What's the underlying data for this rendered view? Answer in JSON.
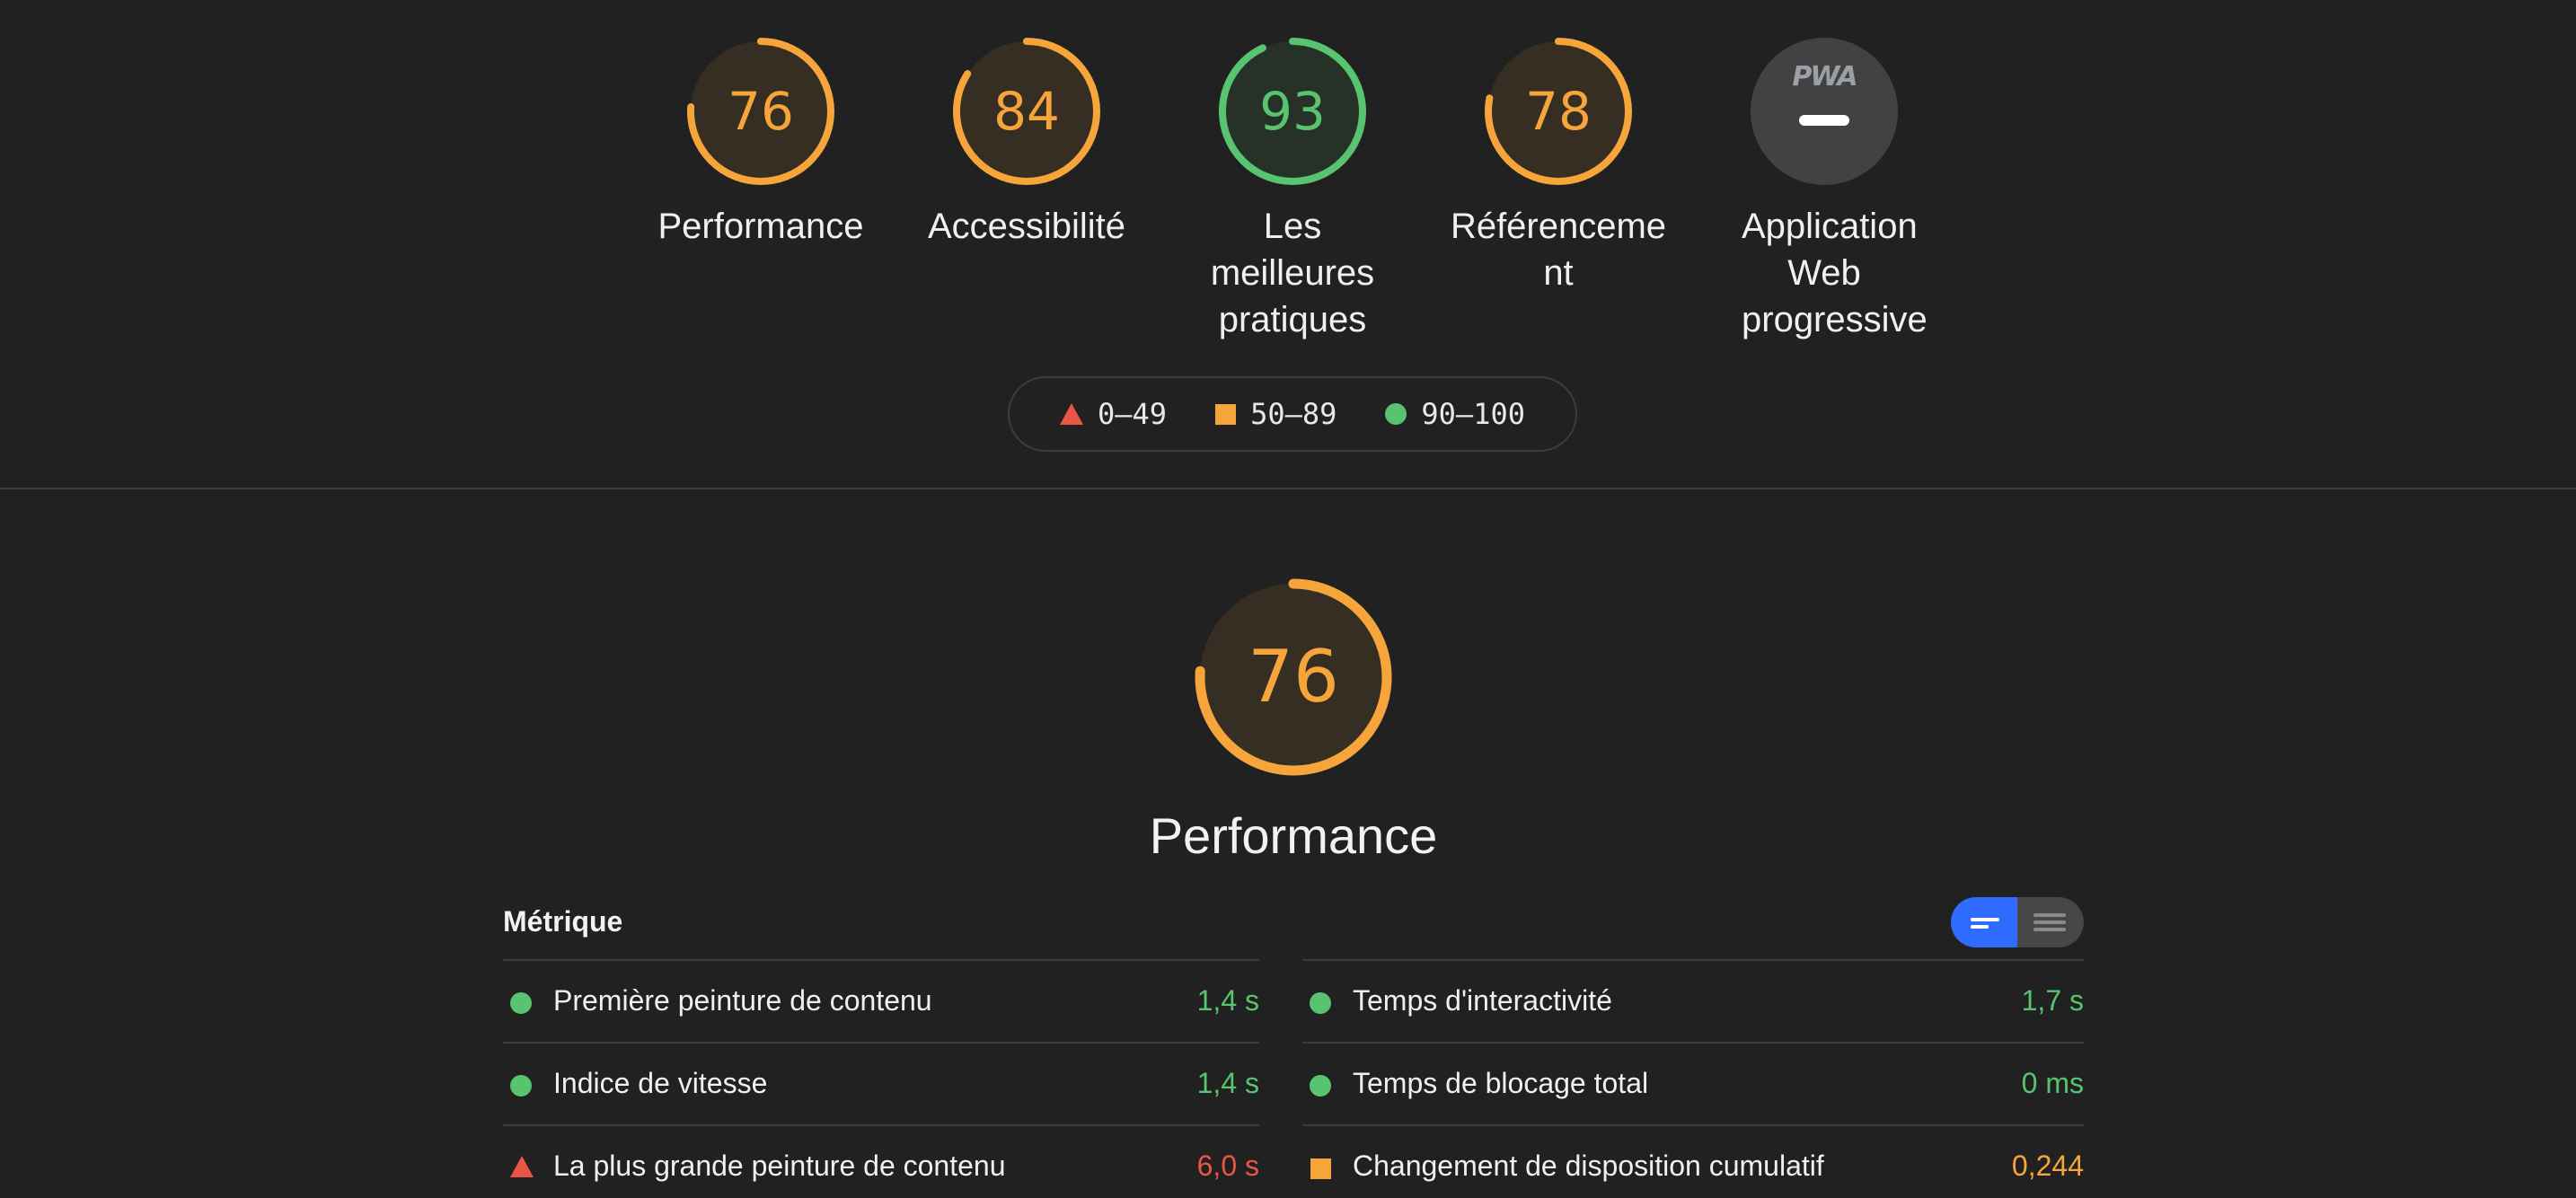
{
  "colors": {
    "background": "#212121",
    "fail": "#eb5545",
    "average": "#f6a53b",
    "pass": "#58c46f",
    "neutral": "#9aa0a6",
    "toggle_active": "#2f6bff"
  },
  "categories": [
    {
      "id": "performance",
      "score": "76",
      "label": "Performance",
      "rating": "average",
      "progress": 0.76
    },
    {
      "id": "accessibility",
      "score": "84",
      "label": "Accessibilité",
      "rating": "average",
      "progress": 0.84
    },
    {
      "id": "best-practices",
      "score": "93",
      "label": "Les meilleures pratiques",
      "rating": "pass",
      "progress": 0.93
    },
    {
      "id": "seo",
      "score": "78",
      "label": "Référencement",
      "rating": "average",
      "progress": 0.78
    },
    {
      "id": "pwa",
      "badge_icon": "pwa-logo-icon",
      "badge_text": "PWA",
      "label": "Application Web progressive",
      "rating": "neutral"
    }
  ],
  "legend": [
    {
      "shape": "triangle",
      "color": "#eb5545",
      "label": "0–49"
    },
    {
      "shape": "square",
      "color": "#f6a53b",
      "label": "50–89"
    },
    {
      "shape": "circle",
      "color": "#58c46f",
      "label": "90–100"
    }
  ],
  "performance": {
    "score": "76",
    "progress": 0.76,
    "title": "Performance",
    "metrics_header": "Métrique",
    "view_toggle": {
      "active": "detailed-view-icon",
      "inactive": "list-view-icon"
    },
    "metrics_left": [
      {
        "icon": "circle",
        "name": "Première peinture de contenu",
        "value": "1,4 s",
        "rating": "pass"
      },
      {
        "icon": "circle",
        "name": "Indice de vitesse",
        "value": "1,4 s",
        "rating": "pass"
      },
      {
        "icon": "triangle",
        "name": "La plus grande peinture de contenu",
        "value": "6,0 s",
        "rating": "fail"
      }
    ],
    "metrics_right": [
      {
        "icon": "circle",
        "name": "Temps d'interactivité",
        "value": "1,7 s",
        "rating": "pass"
      },
      {
        "icon": "circle",
        "name": "Temps de blocage total",
        "value": "0 ms",
        "rating": "pass"
      },
      {
        "icon": "square",
        "name": "Changement de disposition cumulatif",
        "value": "0,244",
        "rating": "average"
      }
    ]
  }
}
